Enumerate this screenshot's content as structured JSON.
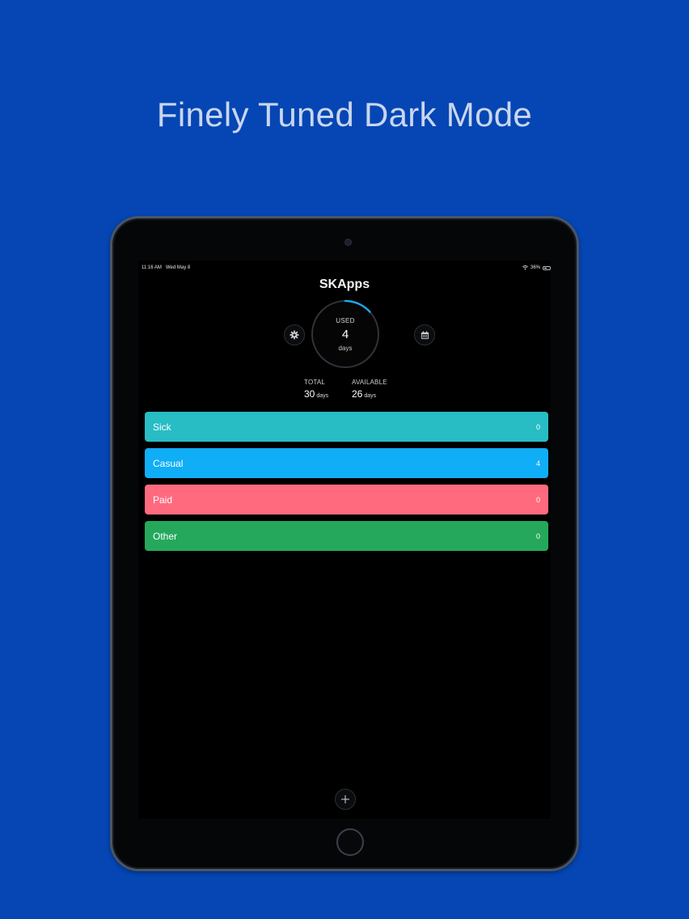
{
  "headline": "Finely Tuned Dark Mode",
  "status_bar": {
    "time": "11:16 AM",
    "date": "Wed May 8",
    "battery": "36%"
  },
  "app": {
    "title": "SKApps",
    "ring": {
      "label": "USED",
      "value": "4",
      "unit": "days",
      "progress": 0.133,
      "accent_color": "#1ea7ea"
    },
    "stats": {
      "total_label": "TOTAL",
      "total_value": "30",
      "total_unit": "days",
      "available_label": "AVAILABLE",
      "available_value": "26",
      "available_unit": "days"
    },
    "categories": [
      {
        "name": "Sick",
        "count": "0",
        "color": "#28bcc4"
      },
      {
        "name": "Casual",
        "count": "4",
        "color": "#10aef6"
      },
      {
        "name": "Paid",
        "count": "0",
        "color": "#ff6a7e"
      },
      {
        "name": "Other",
        "count": "0",
        "color": "#25a85c"
      }
    ],
    "icons": {
      "settings": "gear-icon",
      "calendar": "calendar-icon",
      "add": "plus-icon",
      "home": "home-button-icon"
    }
  }
}
